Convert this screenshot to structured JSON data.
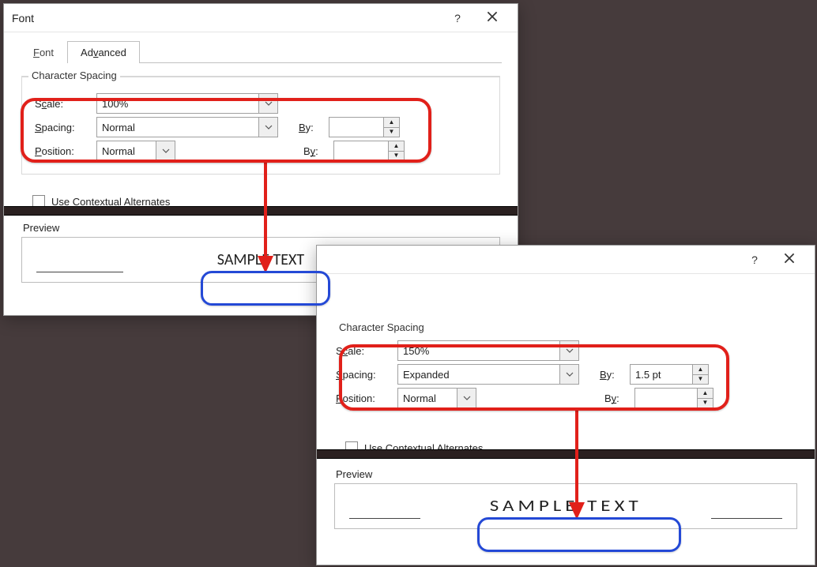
{
  "dialog1": {
    "title": "Font",
    "tabs": {
      "font": "Font",
      "advanced": "Advanced"
    },
    "group_spacing": "Character Spacing",
    "labels": {
      "scale": "Scale:",
      "spacing": "Spacing:",
      "position": "Position:",
      "by": "By:"
    },
    "scale_value": "100%",
    "spacing_value": "Normal",
    "spacing_by": "",
    "position_value": "Normal",
    "position_by": "",
    "alternates": "Use Contextual Alternates",
    "preview_label": "Preview",
    "sample": "SAMPLE TEXT"
  },
  "dialog2": {
    "group_spacing": "Character Spacing",
    "labels": {
      "scale": "Scale:",
      "spacing": "Spacing:",
      "position": "Position:",
      "by": "By:"
    },
    "scale_value": "150%",
    "spacing_value": "Expanded",
    "spacing_by": "1.5 pt",
    "position_value": "Normal",
    "position_by": "",
    "alternates": "Use Contextual Alternates",
    "preview_label": "Preview",
    "sample": "SAMPLE TEXT"
  },
  "underlined": {
    "font_tab_f": "F",
    "advanced_tab_v": "v",
    "scale_c": "c",
    "spacing_s": "S",
    "position_p": "P",
    "by_b": "B",
    "alternates_a": "A"
  }
}
